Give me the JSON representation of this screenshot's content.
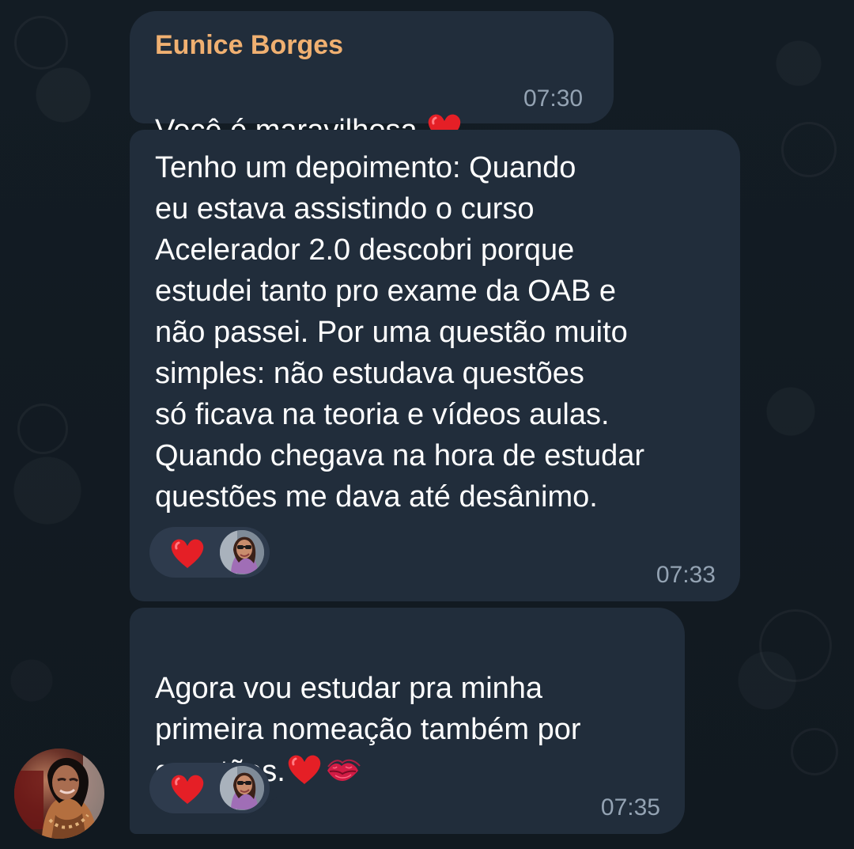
{
  "chat": {
    "messages": [
      {
        "sender": "Eunice Borges",
        "text": "Você é maravilhosa",
        "time": "07:30",
        "emoji": "red-heart-icon"
      },
      {
        "text": "Tenho um depoimento: Quando\neu estava assistindo o curso\nAcelerador 2.0 descobri porque\nestudei tanto pro exame da OAB e\nnão passei. Por uma questão muito\nsimples: não estudava questões\nsó ficava na teoria e vídeos aulas.\nQuando chegava na hora de estudar\nquestões me dava até desânimo.",
        "time": "07:33",
        "reaction": "red-heart-icon"
      },
      {
        "text": "Agora vou estudar pra minha\nprimeira nomeação também por\nquestões.",
        "time": "07:35",
        "emojis": [
          "red-heart-icon",
          "kiss-mark-icon"
        ],
        "reaction": "red-heart-icon"
      }
    ]
  },
  "colors": {
    "background": "#121a22",
    "bubble": "#212d3b",
    "reaction_pill": "#2e3b4d",
    "sender_name": "#f0b071",
    "timestamp": "#94a3b3",
    "text": "#ffffff"
  }
}
